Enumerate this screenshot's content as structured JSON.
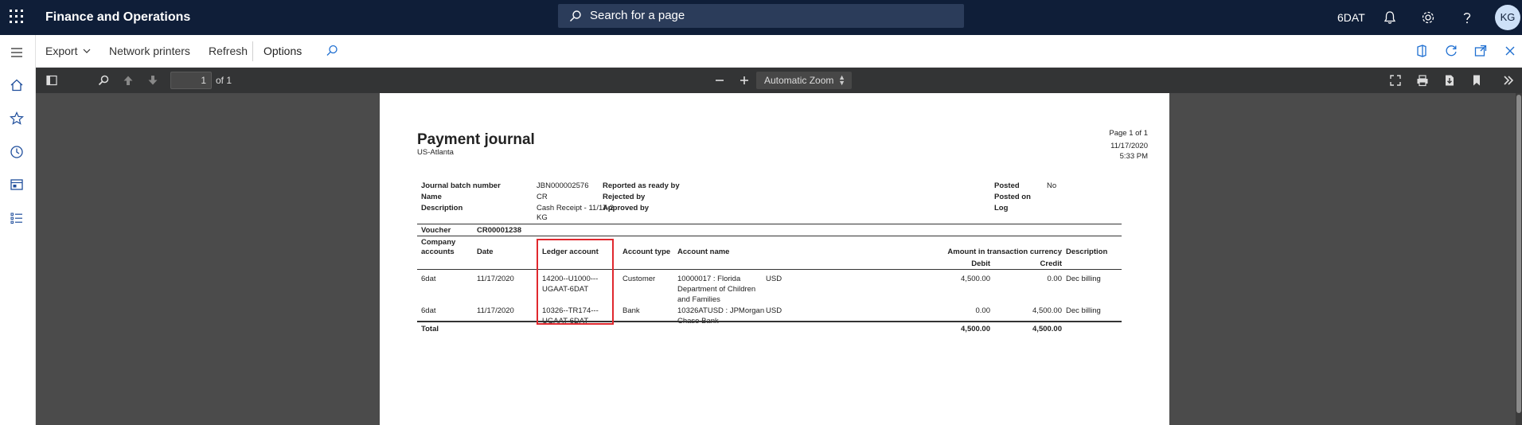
{
  "app": {
    "title": "Finance and Operations",
    "company": "6DAT",
    "user_initials": "KG"
  },
  "search": {
    "placeholder": "Search for a page"
  },
  "nav_icons": [
    "menu-icon",
    "home-icon",
    "star-icon",
    "clock-icon",
    "workspace-icon",
    "list-icon"
  ],
  "actions": {
    "export_label": "Export",
    "network_printers_label": "Network printers",
    "refresh_label": "Refresh",
    "options_label": "Options"
  },
  "pdf_toolbar": {
    "page_number": "1",
    "page_of": "of 1",
    "zoom": "Automatic Zoom"
  },
  "report": {
    "title": "Payment journal",
    "subtitle": "US-Atlanta",
    "page_info": "Page 1 of 1",
    "date": "11/17/2020",
    "time": "5:33 PM",
    "header": {
      "journal_batch_number_label": "Journal batch number",
      "journal_batch_number": "JBN000002576",
      "name_label": "Name",
      "name": "CR",
      "description_label": "Description",
      "description_line1": "Cash Receipt - 11/17-2",
      "description_line2": "KG",
      "reported_label": "Reported as ready by",
      "rejected_label": "Rejected by",
      "approved_label": "Approved by",
      "posted_label": "Posted",
      "posted": "No",
      "posted_on_label": "Posted on",
      "log_label": "Log"
    },
    "voucher_label": "Voucher",
    "voucher": "CR00001238",
    "columns": {
      "company_1": "Company",
      "company_2": "accounts",
      "date": "Date",
      "ledger_account": "Ledger account",
      "account_type": "Account type",
      "account_name": "Account name",
      "amount_group": "Amount in transaction currency",
      "debit": "Debit",
      "credit": "Credit",
      "description": "Description"
    },
    "rows": [
      {
        "company": "6dat",
        "date": "11/17/2020",
        "ledger_1": "14200--U1000---",
        "ledger_2": "UGAAT-6DAT",
        "account_type": "Customer",
        "name_1": "10000017 : Florida",
        "name_2": "Department of Children",
        "name_3": "and Families",
        "currency": "USD",
        "debit": "4,500.00",
        "credit": "0.00",
        "description": "Dec billing"
      },
      {
        "company": "6dat",
        "date": "11/17/2020",
        "ledger_1": "10326--TR174---",
        "ledger_2": "UGAAT-6DAT",
        "account_type": "Bank",
        "name_1": "10326ATUSD : JPMorgan",
        "name_2": "Chase Bank",
        "currency": "USD",
        "debit": "0.00",
        "credit": "4,500.00",
        "description": "Dec billing"
      }
    ],
    "total_label": "Total",
    "total_debit": "4,500.00",
    "total_credit": "4,500.00"
  }
}
